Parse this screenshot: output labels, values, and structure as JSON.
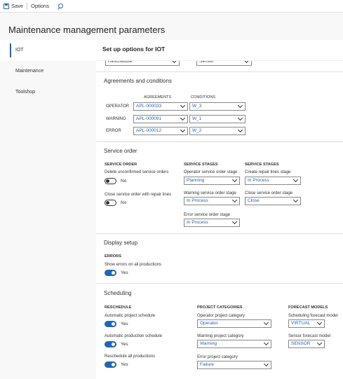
{
  "toolbar": {
    "save_label": "Save",
    "options_label": "Options"
  },
  "page": {
    "title": "Maintenance management parameters"
  },
  "nav": {
    "items": [
      {
        "label": "IOT"
      },
      {
        "label": "Maintenance"
      },
      {
        "label": "Toolshop"
      }
    ]
  },
  "content": {
    "title": "Set up options for IOT",
    "top_selects": {
      "left": "Reschedule",
      "right": "Sensor"
    },
    "agreements": {
      "title": "Agreements and conditions",
      "col_agreements": "AGREEMENTS",
      "col_conditions": "CONDITIONS",
      "rows": [
        {
          "label": "OPERATOR",
          "agreement": "APL-000033",
          "condition": "W_3"
        },
        {
          "label": "WARNING",
          "agreement": "APL-000091",
          "condition": "W_1"
        },
        {
          "label": "ERROR",
          "agreement": "APL-000012",
          "condition": "W_2"
        }
      ]
    },
    "service_order": {
      "title": "Service order",
      "col1_header": "SERVICE ORDER",
      "col2_header": "SERVICE STAGES",
      "col3_header": "SERVICE STAGES",
      "delete_label": "Delete unconfirmed service orders",
      "delete_value": "No",
      "close_label": "Close service order with repair lines",
      "close_value": "No",
      "operator_stage_label": "Operator service order stage",
      "operator_stage_value": "Planning",
      "warning_stage_label": "Warning service order stage",
      "warning_stage_value": "In Process",
      "error_stage_label": "Error service order stage",
      "error_stage_value": "In Process",
      "create_repair_label": "Create repair lines stage",
      "create_repair_value": "In Process",
      "close_stage_label": "Close service order stage",
      "close_stage_value": "Close"
    },
    "display": {
      "title": "Display setup",
      "header": "ERRORS",
      "show_errors_label": "Show errors on all productions",
      "show_errors_value": "Yes"
    },
    "scheduling": {
      "title": "Scheduling",
      "col1_header": "RESCHEDULE",
      "col2_header": "PROJECT CATEGORIES",
      "col3_header": "FORECAST MODELS",
      "auto_project_label": "Automatic project schedule",
      "auto_project_value": "Yes",
      "auto_production_label": "Automatic production schedule",
      "auto_production_value": "Yes",
      "reschedule_all_label": "Reschedule all productions",
      "reschedule_all_value": "Yes",
      "operator_cat_label": "Operator project category",
      "operator_cat_value": "Operator",
      "warning_cat_label": "Warning project category",
      "warning_cat_value": "Warning",
      "error_cat_label": "Error project category",
      "error_cat_value": "Failure",
      "sched_forecast_label": "Scheduling forecast model",
      "sched_forecast_value": "VIRTUAL",
      "sensor_forecast_label": "Sensor forecast model",
      "sensor_forecast_value": "SENSOR"
    }
  },
  "colors": {
    "accent": "#2266b2",
    "border": "#8a8886"
  }
}
